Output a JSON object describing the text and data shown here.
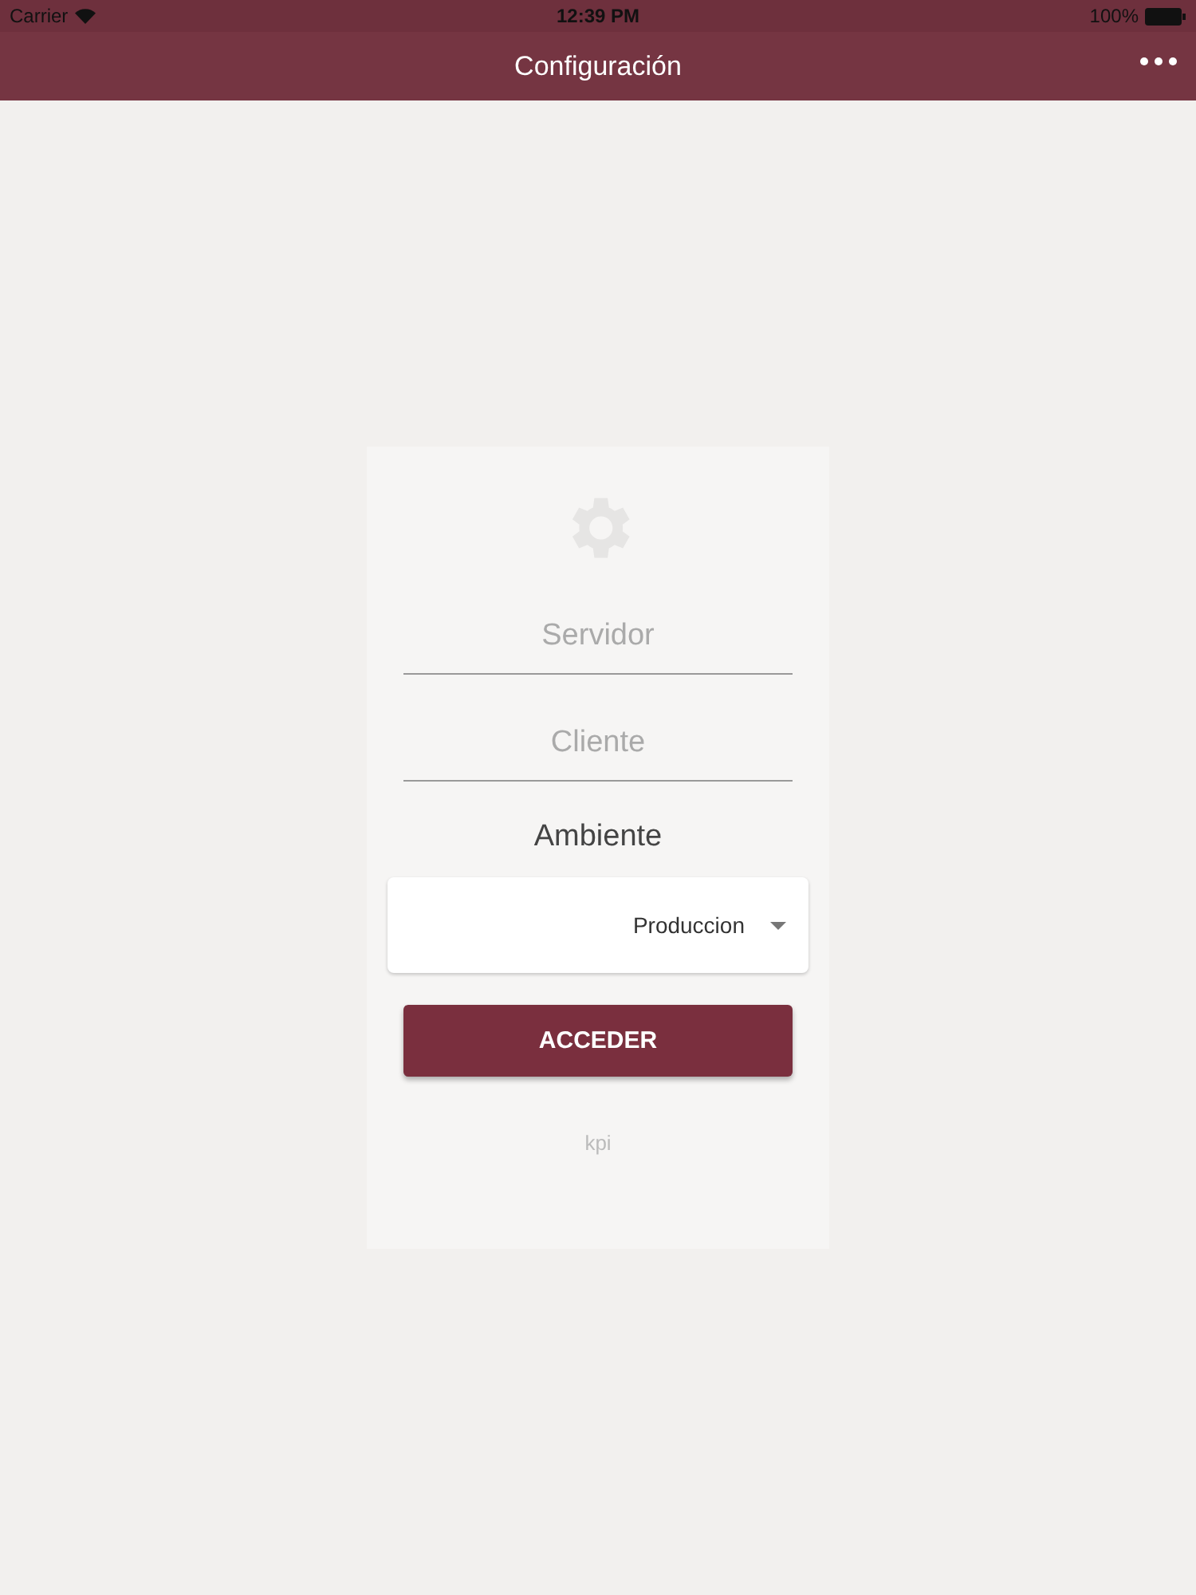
{
  "status_bar": {
    "carrier": "Carrier",
    "time": "12:39 PM",
    "battery": "100%"
  },
  "nav_bar": {
    "title": "Configuración"
  },
  "form": {
    "fields": [
      {
        "placeholder": "Servidor"
      },
      {
        "placeholder": "Cliente"
      }
    ],
    "select_label": "Ambiente",
    "select_value": "Produccion",
    "button": "ACCEDER",
    "logo": "kpi"
  }
}
